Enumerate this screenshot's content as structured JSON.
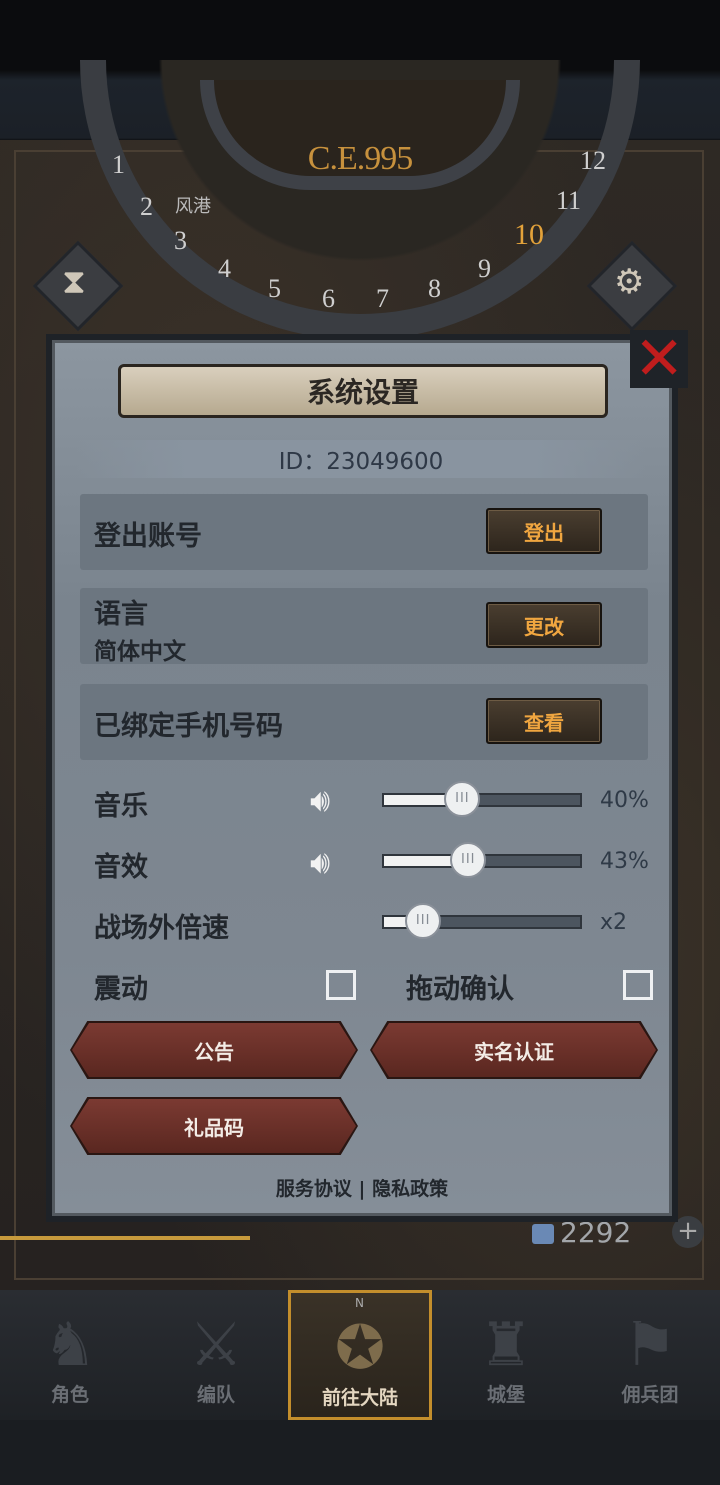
{
  "map": {
    "era": "C.E.995",
    "port_label": "风港",
    "dial_numbers": [
      "1",
      "2",
      "3",
      "4",
      "5",
      "6",
      "7",
      "8",
      "9",
      "10",
      "11",
      "12"
    ],
    "current_month": "10"
  },
  "dialog": {
    "title": "系统设置",
    "id_text": "ID：23049600",
    "rows": [
      {
        "label": "登出账号",
        "sub": "",
        "button": "登出"
      },
      {
        "label": "语言",
        "sub": "简体中文",
        "button": "更改"
      },
      {
        "label": "已绑定手机号码",
        "sub": "",
        "button": "查看"
      }
    ],
    "music": {
      "label": "音乐",
      "value": 0.4,
      "display": "40%"
    },
    "sfx": {
      "label": "音效",
      "value": 0.43,
      "display": "43%"
    },
    "speed": {
      "label": "战场外倍速",
      "value": 0.2,
      "display": "x2"
    },
    "vibrate": {
      "label": "震动",
      "checked": false
    },
    "drag_confirm": {
      "label": "拖动确认",
      "checked": false
    },
    "buttons": {
      "announcement": "公告",
      "real_name": "实名认证",
      "gift_code": "礼品码"
    },
    "footer": {
      "service": "服务协议",
      "sep": "|",
      "privacy": "隐私政策"
    },
    "close_icon": "close-icon"
  },
  "resource": {
    "value": "2292"
  },
  "nav": {
    "items": [
      "角色",
      "编队",
      "前往大陆",
      "城堡",
      "佣兵团"
    ],
    "active_index": 2,
    "compass_n": "N"
  },
  "colors": {
    "accent_gold": "#c38e2c",
    "close_red": "#c01d1d",
    "button_text": "#f0a640"
  }
}
